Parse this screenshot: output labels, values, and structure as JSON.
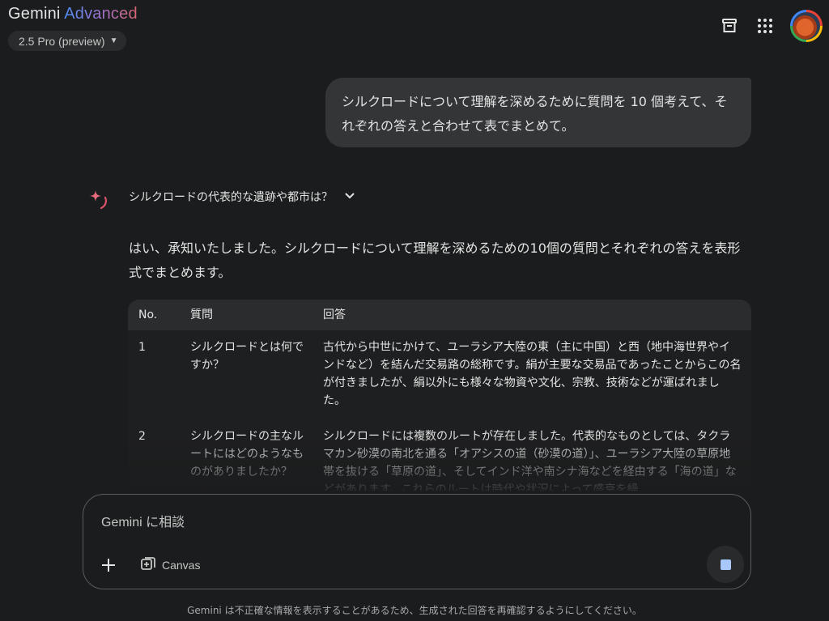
{
  "header": {
    "brand_main": "Gemini",
    "brand_accent": "Advanced",
    "model": "2.5 Pro (preview)"
  },
  "conversation": {
    "user_message": "シルクロードについて理解を深めるために質問を 10 個考えて、それぞれの答えと合わせて表でまとめて。",
    "thought_title": "シルクロードの代表的な遺跡や都市は？",
    "response_intro": "はい、承知いたしました。シルクロードについて理解を深めるための10個の質問とそれぞれの答えを表形式でまとめます。",
    "table": {
      "headers": [
        "No.",
        "質問",
        "回答"
      ],
      "rows": [
        {
          "no": "1",
          "question": "シルクロードとは何ですか？",
          "answer": "古代から中世にかけて、ユーラシア大陸の東（主に中国）と西（地中海世界やインドなど）を結んだ交易路の総称です。絹が主要な交易品であったことからこの名が付きましたが、絹以外にも様々な物資や文化、宗教、技術などが運ばれました。"
        },
        {
          "no": "2",
          "question": "シルクロードの主なルートにはどのようなものがありましたか？",
          "answer": "シルクロードには複数のルートが存在しました。代表的なものとしては、タクラマカン砂漠の南北を通る「オアシスの道（砂漠の道）」、ユーラシア大陸の草原地帯を抜ける「草原の道」、そしてインド洋や南シナ海などを経由する「海の道」などがあります。これらのルートは時代や状況によって盛衰を繰"
        }
      ]
    }
  },
  "input": {
    "placeholder": "Gemini に相談",
    "canvas_label": "Canvas"
  },
  "footer": {
    "disclaimer": "Gemini は不正確な情報を表示することがあるため、生成された回答を再確認するようにしてください。"
  },
  "colors": {
    "background": "#1b1c1d",
    "bubble": "#333537",
    "table_header": "#2b2c2e",
    "accent_blue": "#4f8df5",
    "accent_pink": "#d96570",
    "send_square": "#a8c7fa"
  },
  "icons": [
    "archive-icon",
    "apps-grid-icon",
    "avatar",
    "sparkle-icon",
    "chevron-down-icon",
    "plus-icon",
    "canvas-icon",
    "stop-icon"
  ]
}
